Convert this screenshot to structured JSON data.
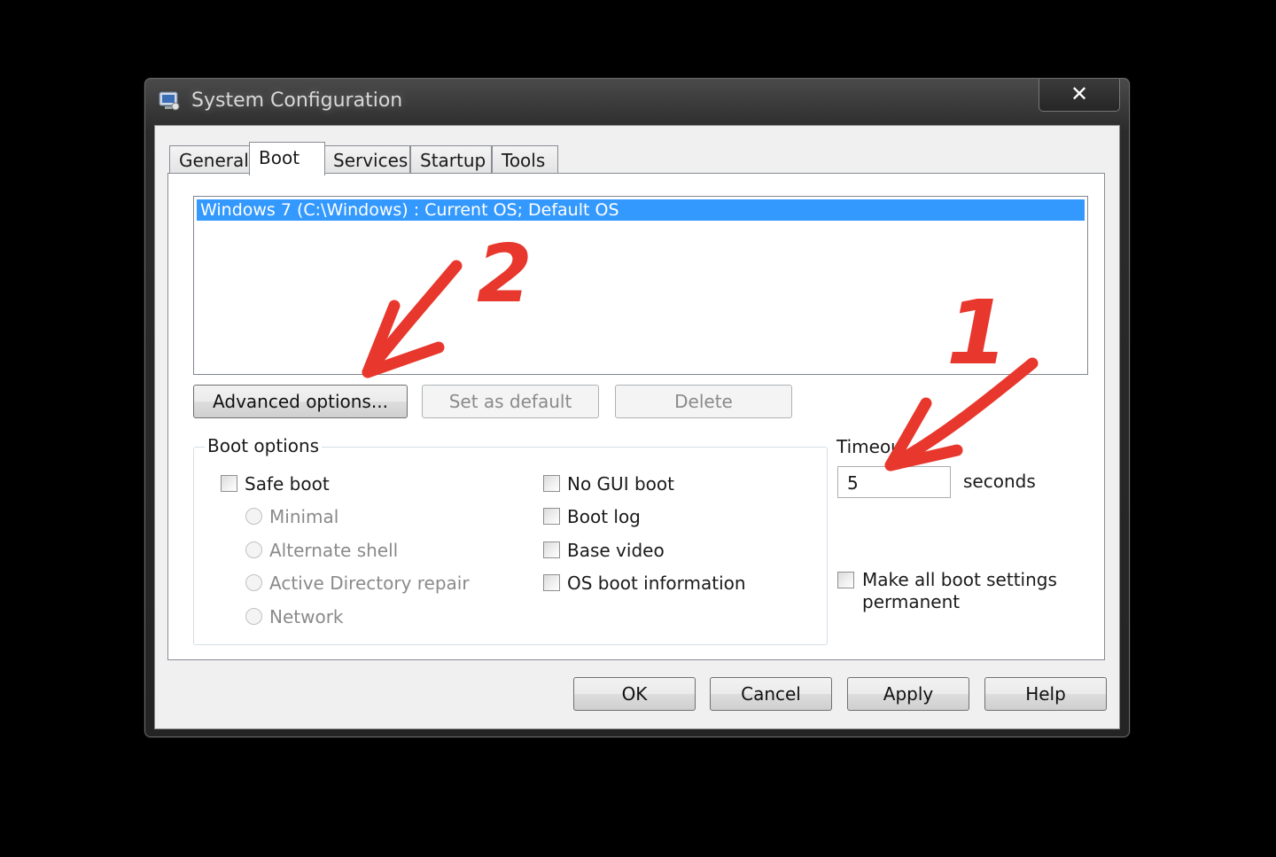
{
  "window": {
    "title": "System Configuration",
    "close_label": "✕"
  },
  "tabs": [
    {
      "label": "General"
    },
    {
      "label": "Boot"
    },
    {
      "label": "Services"
    },
    {
      "label": "Startup"
    },
    {
      "label": "Tools"
    }
  ],
  "active_tab": "Boot",
  "os_list": {
    "items": [
      "Windows 7 (C:\\Windows) : Current OS; Default OS"
    ]
  },
  "list_buttons": {
    "advanced": "Advanced options...",
    "set_default": "Set as default",
    "delete": "Delete"
  },
  "boot_options": {
    "legend": "Boot options",
    "safe_boot": "Safe boot",
    "radios": [
      "Minimal",
      "Alternate shell",
      "Active Directory repair",
      "Network"
    ],
    "checks": [
      "No GUI boot",
      "Boot log",
      "Base video",
      "OS boot information"
    ]
  },
  "timeout": {
    "label": "Timeou",
    "value": "5",
    "unit": "seconds"
  },
  "permanent": {
    "line1": "Make all boot settings",
    "line2": "permanent"
  },
  "footer": {
    "ok": "OK",
    "cancel": "Cancel",
    "apply": "Apply",
    "help": "Help"
  },
  "annotations": {
    "marker_1": "1",
    "marker_2": "2",
    "color": "#e8372c"
  },
  "colors": {
    "selection": "#3399ff"
  }
}
